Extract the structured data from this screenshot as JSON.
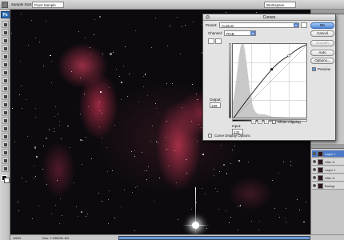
{
  "options_bar": {
    "sample_size_label": "Sample Size:",
    "sample_size_value": "Point Sample",
    "workspace_label": "Workspace"
  },
  "toolbox": {
    "logo": "Ps"
  },
  "curves": {
    "title": "Curves",
    "preset_label": "Preset:",
    "preset_value": "Custom",
    "channel_label": "Channel:",
    "channel_value": "RGB",
    "output_label": "Output:",
    "output_value": "169",
    "input_label": "Input:",
    "input_value": "132",
    "show_clipping_label": "Show Clipping",
    "show_clipping_checked": false,
    "display_options_label": "Curve Display Options",
    "buttons": {
      "ok": "OK",
      "cancel": "Cancel",
      "smooth": "Smooth",
      "auto": "Auto",
      "options": "Options..."
    },
    "preview_label": "Preview",
    "preview_checked": true,
    "curve_points": [
      [
        0,
        0
      ],
      [
        132,
        169
      ],
      [
        190,
        215
      ],
      [
        255,
        255
      ]
    ]
  },
  "layers": {
    "items": [
      {
        "label": "Layer 1"
      },
      {
        "label": "After H"
      },
      {
        "label": "Layer 1"
      },
      {
        "label": "After H"
      },
      {
        "label": "Backgr"
      }
    ],
    "active_index": 0
  },
  "status_bar": {
    "zoom": "100%",
    "doc": "Doc: 7.29M/31.1M"
  },
  "colors": {
    "nebula": "#c83250",
    "ok_button": "#4b86d8",
    "selected_layer": "#4b79c7"
  }
}
